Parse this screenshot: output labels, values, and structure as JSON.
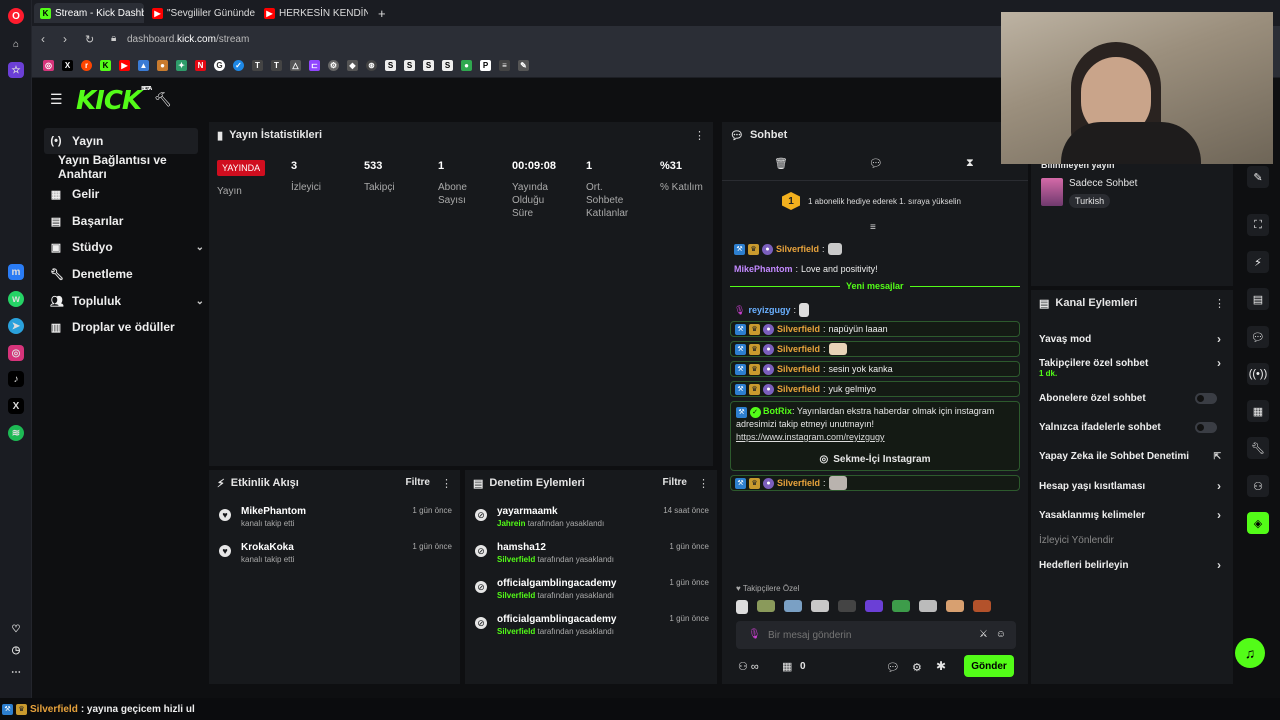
{
  "browser": {
    "tabs": [
      {
        "label": "Stream - Kick Dashboard",
        "active": true
      },
      {
        "label": "\"Sevgililer Gününde Güld…",
        "active": false
      },
      {
        "label": "HERKESİN KENDİNE YAKIŞ…",
        "active": false
      }
    ],
    "url_prefix": "dashboard.",
    "url_domain": "kick.com",
    "url_path": "/stream"
  },
  "logo": {
    "text": "KICK",
    "beta": "BETA"
  },
  "sidebar": {
    "items": [
      {
        "label": "Yayın",
        "icon": "broadcast-icon"
      },
      {
        "label": "Yayın Bağlantısı ve Anahtarı",
        "icon": ""
      },
      {
        "label": "Gelir",
        "icon": "money-icon"
      },
      {
        "label": "Başarılar",
        "icon": "trophy-icon"
      },
      {
        "label": "Stüdyo",
        "icon": "studio-icon"
      },
      {
        "label": "Denetleme",
        "icon": "wrench-icon"
      },
      {
        "label": "Topluluk",
        "icon": "people-icon"
      },
      {
        "label": "Droplar ve ödüller",
        "icon": "gift-icon"
      }
    ]
  },
  "stats": {
    "title": "Yayın İstatistikleri",
    "live_badge": "YAYINDA",
    "live_label": "Yayın",
    "items": [
      {
        "value": "3",
        "label": "İzleyici"
      },
      {
        "value": "533",
        "label": "Takipçi"
      },
      {
        "value": "1",
        "label": "Abone Sayısı"
      },
      {
        "value": "00:09:08",
        "label": "Yayında Olduğu Süre"
      },
      {
        "value": "1",
        "label": "Ort. Sohbete Katılanlar"
      },
      {
        "value": "%31",
        "label": "% Katılım"
      }
    ]
  },
  "activity": {
    "title": "Etkinlik Akışı",
    "filter": "Filtre",
    "items": [
      {
        "name": "MikePhantom",
        "sub": "kanalı takip etti",
        "time": "1 gün önce"
      },
      {
        "name": "KrokaKoka",
        "sub": "kanalı takip etti",
        "time": "1 gün önce"
      }
    ]
  },
  "moderation": {
    "title": "Denetim Eylemleri",
    "filter": "Filtre",
    "suffix": "tarafından yasaklandı",
    "items": [
      {
        "name": "yayarmaamk",
        "by": "Jahrein",
        "time": "14 saat önce"
      },
      {
        "name": "hamsha12",
        "by": "Silverfield",
        "time": "1 gün önce"
      },
      {
        "name": "officialgamblingacademy",
        "by": "Silverfield",
        "time": "1 gün önce"
      },
      {
        "name": "officialgamblingacademy",
        "by": "Silverfield",
        "time": "1 gün önce"
      }
    ]
  },
  "chat": {
    "title": "Sohbet",
    "gift_rank": "1",
    "gift_text": "1 abonelik hediye ederek 1. sıraya yükselin",
    "new_messages": "Yeni mesajlar",
    "messages": [
      {
        "user": "Silverfield",
        "text": "",
        "emote": true
      },
      {
        "user": "MikePhantom",
        "text": "Love and positivity!",
        "emote": false
      },
      {
        "user": "reyizgugy",
        "text": "",
        "emote": true
      },
      {
        "user": "Silverfield",
        "text": "napüyün laaan",
        "emote": false
      },
      {
        "user": "Silverfield",
        "text": "",
        "emote": true
      },
      {
        "user": "Silverfield",
        "text": "sesin yok kanka",
        "emote": false
      },
      {
        "user": "Silverfield",
        "text": "yuk gelmiyo",
        "emote": false
      },
      {
        "user": "Silverfield",
        "text": "",
        "emote": true
      }
    ],
    "bot": {
      "user": "BotRix",
      "text": "Yayınlardan ekstra haberdar olmak için instagram adresimizi takip etmeyi unutmayın!",
      "link": "https://www.instagram.com/reyizgugy",
      "button": "Sekme-İçi Instagram"
    },
    "followers_only": "Takipçilere Özel",
    "input_placeholder": "Bir mesaj gönderin",
    "points": "0",
    "send": "Gönder",
    "colors": {
      "silverfield": "#e8a33c",
      "mike": "#c389ff",
      "reyiz": "#6ab0ff",
      "bot": "#53fc18"
    }
  },
  "stream_info": {
    "title": "Bilinmeyen yayın",
    "category": "Sadece Sohbet",
    "tag": "Turkish"
  },
  "channel_actions": {
    "title": "Kanal Eylemleri",
    "items": [
      {
        "label": "Yavaş mod",
        "type": "chevron"
      },
      {
        "label": "Takipçilere özel sohbet",
        "sub": "1 dk.",
        "type": "chevron"
      },
      {
        "label": "Abonelere özel sohbet",
        "type": "toggle"
      },
      {
        "label": "Yalnızca ifadelerle sohbet",
        "type": "toggle"
      },
      {
        "label": "Yapay Zeka ile Sohbet Denetimi",
        "type": "external"
      },
      {
        "label": "Hesap yaşı kısıtlaması",
        "type": "chevron"
      },
      {
        "label": "Yasaklanmış kelimeler",
        "type": "chevron"
      },
      {
        "label": "İzleyici Yönlendir",
        "type": "disabled"
      },
      {
        "label": "Hedefleri belirleyin",
        "type": "chevron"
      }
    ]
  },
  "ticker": {
    "user": "Silverfield",
    "text": ": yayına geçicem hizli ul"
  }
}
